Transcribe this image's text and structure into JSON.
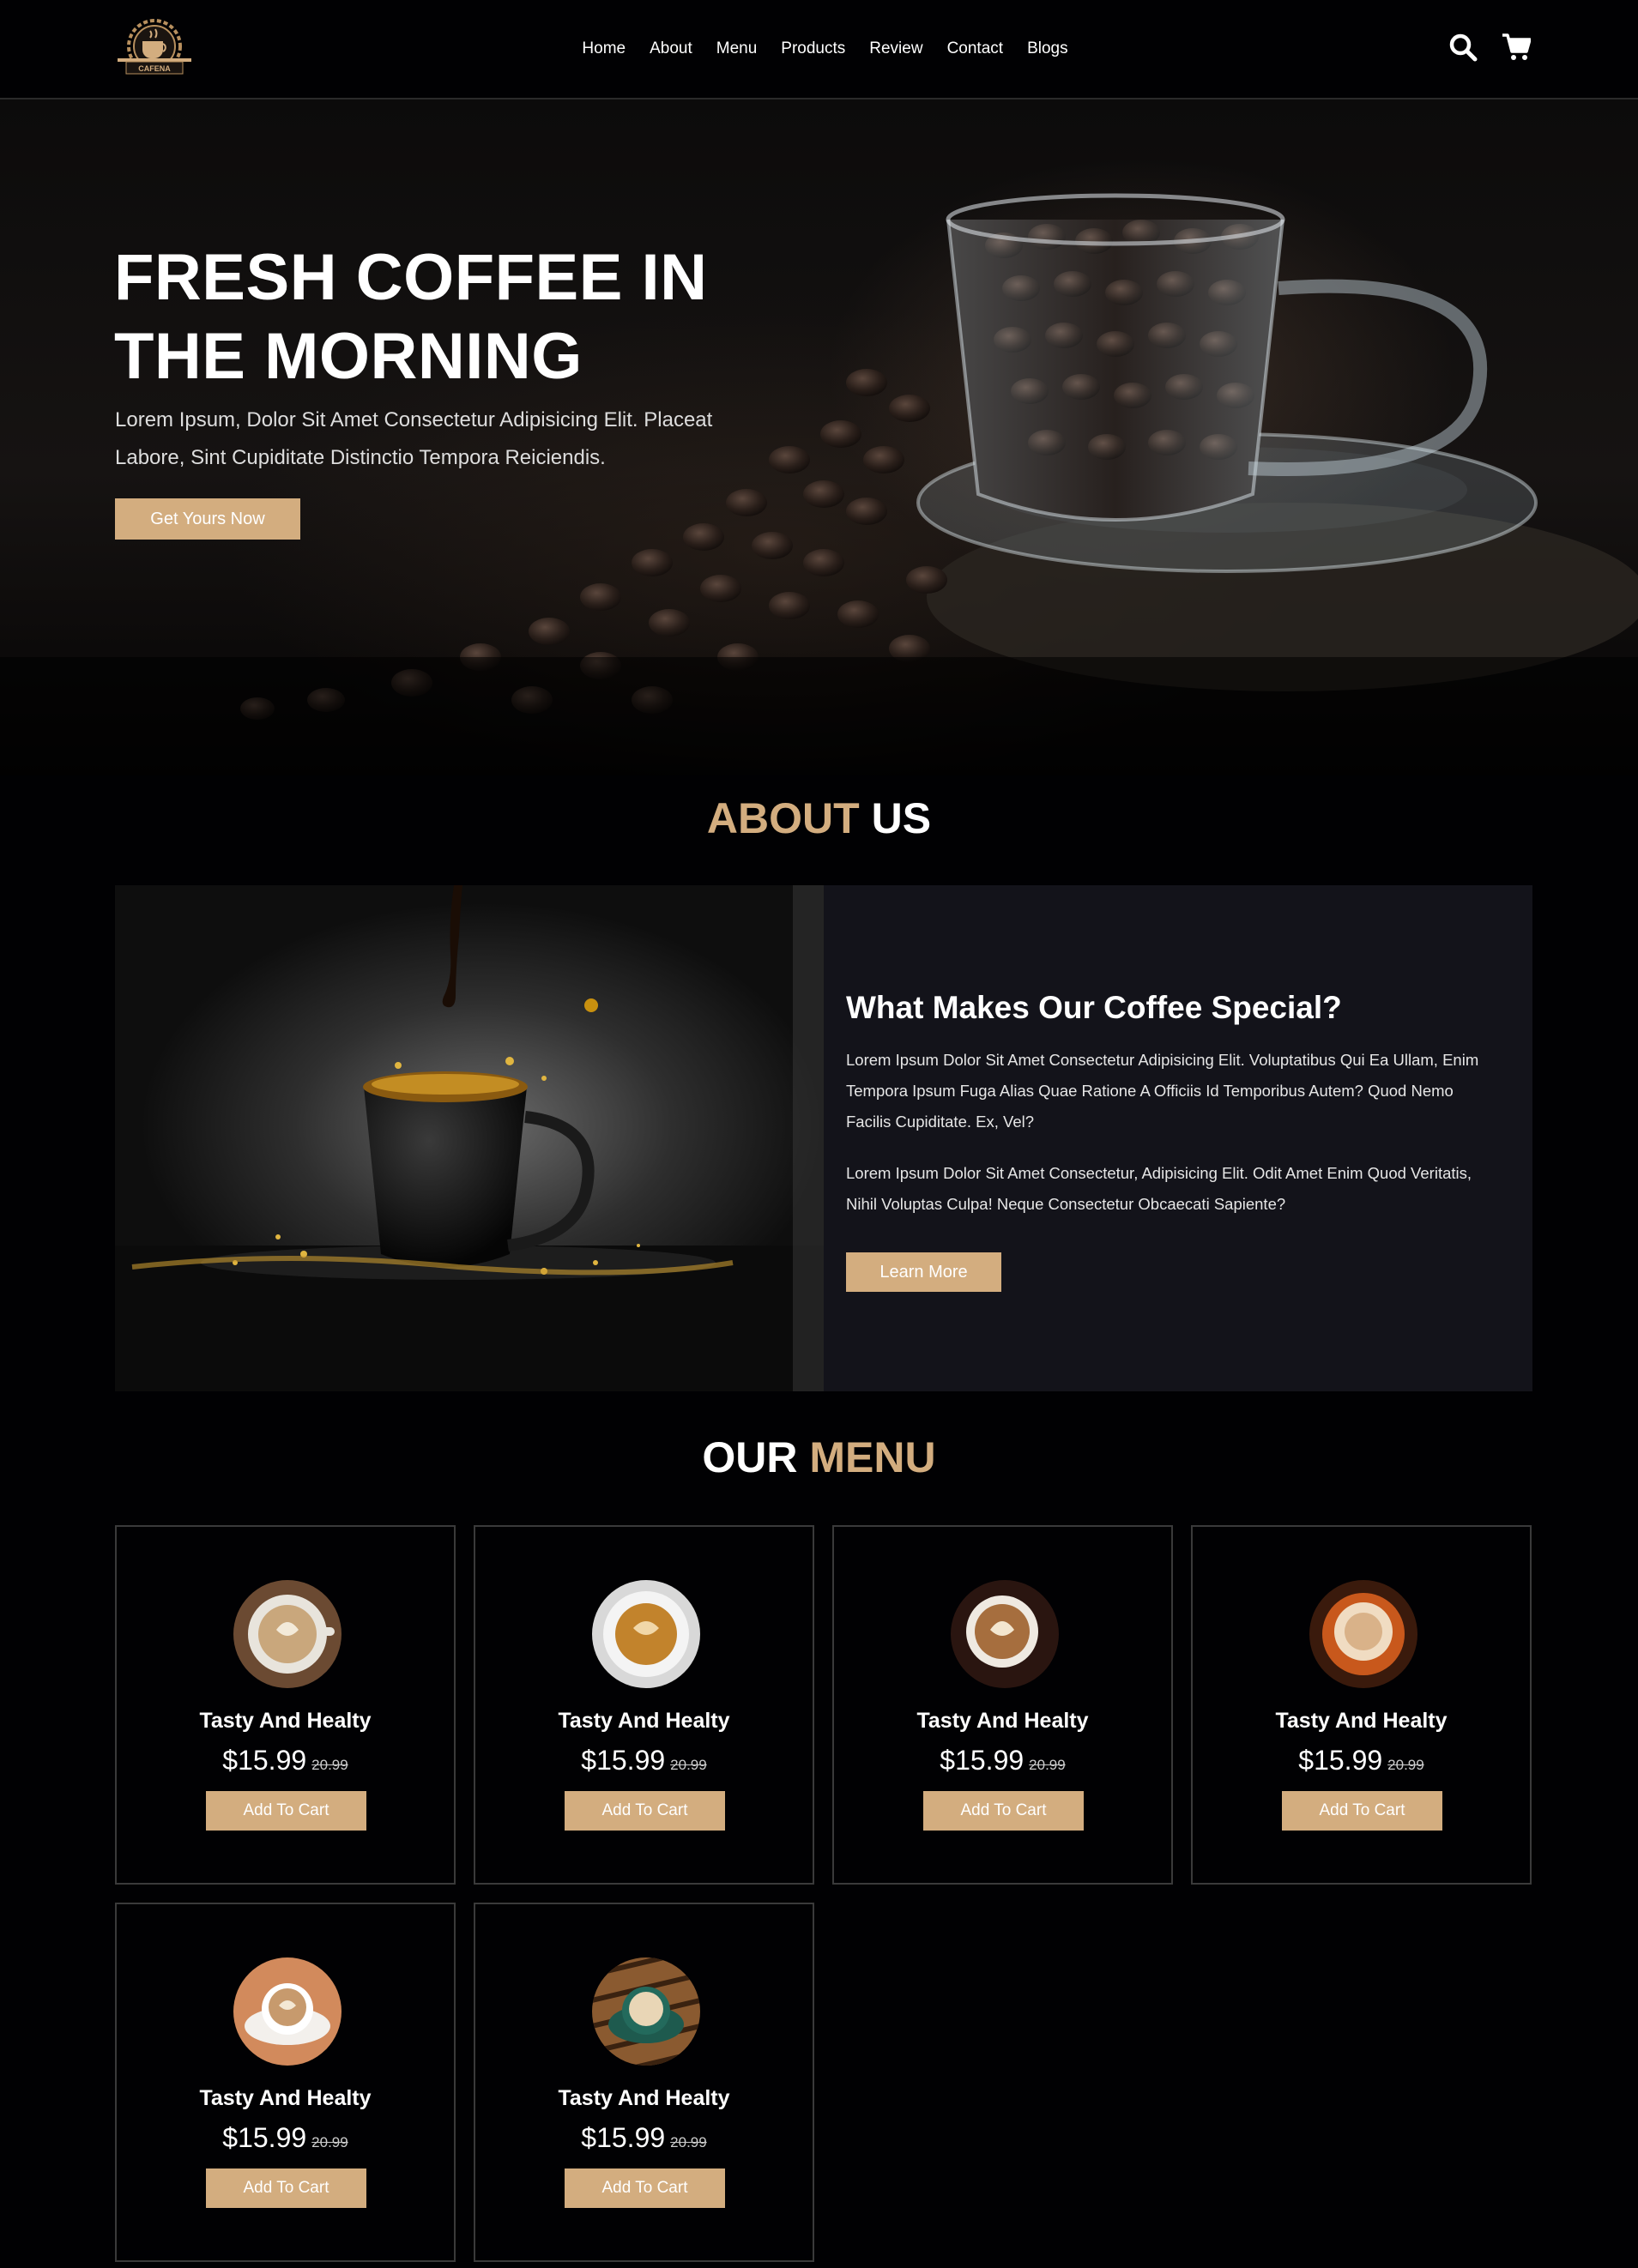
{
  "brand": {
    "logo_text": "CAFENA"
  },
  "nav": {
    "items": [
      "Home",
      "About",
      "Menu",
      "Products",
      "Review",
      "Contact",
      "Blogs"
    ]
  },
  "header_icons": {
    "search": "search-icon",
    "cart": "cart-icon"
  },
  "hero": {
    "title": "Fresh Coffee In The Morning",
    "text": "Lorem Ipsum, Dolor Sit Amet Consectetur Adipisicing Elit. Placeat Labore, Sint Cupiditate Distinctio Tempora Reiciendis.",
    "button": "Get Yours Now"
  },
  "about": {
    "title_accent": "About",
    "title_rest": "Us",
    "heading": "What Makes Our Coffee Special?",
    "p1": "Lorem Ipsum Dolor Sit Amet Consectetur Adipisicing Elit. Voluptatibus Qui Ea Ullam, Enim Tempora Ipsum Fuga Alias Quae Ratione A Officiis Id Temporibus Autem? Quod Nemo Facilis Cupiditate. Ex, Vel?",
    "p2": "Lorem Ipsum Dolor Sit Amet Consectetur, Adipisicing Elit. Odit Amet Enim Quod Veritatis, Nihil Voluptas Culpa! Neque Consectetur Obcaecati Sapiente?",
    "button": "Learn More"
  },
  "menu": {
    "title_rest": "Our",
    "title_accent": "Menu",
    "items": [
      {
        "name": "Tasty And Healty",
        "price": "$15.99",
        "old_price": "20.99",
        "button": "Add To Cart"
      },
      {
        "name": "Tasty And Healty",
        "price": "$15.99",
        "old_price": "20.99",
        "button": "Add To Cart"
      },
      {
        "name": "Tasty And Healty",
        "price": "$15.99",
        "old_price": "20.99",
        "button": "Add To Cart"
      },
      {
        "name": "Tasty And Healty",
        "price": "$15.99",
        "old_price": "20.99",
        "button": "Add To Cart"
      },
      {
        "name": "Tasty And Healty",
        "price": "$15.99",
        "old_price": "20.99",
        "button": "Add To Cart"
      },
      {
        "name": "Tasty And Healty",
        "price": "$15.99",
        "old_price": "20.99",
        "button": "Add To Cart"
      }
    ]
  },
  "colors": {
    "accent": "#d3ad7f",
    "background": "#010103",
    "panel": "#13131a",
    "border": "#3a3a3a"
  }
}
